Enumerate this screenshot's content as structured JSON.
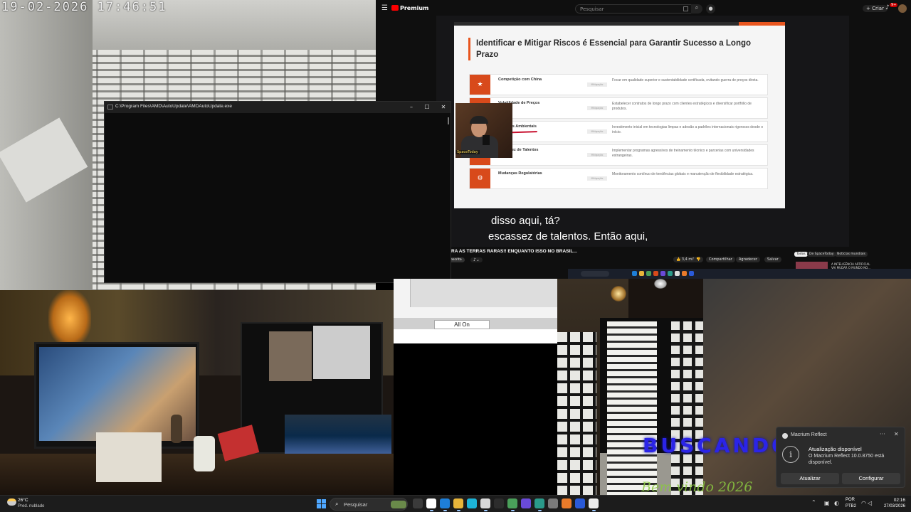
{
  "camera_top_left": {
    "timestamp": "19-02-2026  17:46:51"
  },
  "youtube": {
    "brand": "Premium",
    "search_placeholder": "Pesquisar",
    "create_label": "+ Criar",
    "notification_count": "9+",
    "slide": {
      "title": "Identificar e Mitigar Riscos é Essencial para Garantir Sucesso a Longo Prazo",
      "rows": [
        {
          "name": "Competição com China",
          "tag": "Mitigação",
          "desc": "Focar em qualidade superior e sustentabilidade certificada, evitando guerra de preços direta."
        },
        {
          "name": "Volatilidade de Preços",
          "tag": "Mitigação",
          "desc": "Estabelecer contratos de longo prazo com clientes estratégicos e diversificar portfólio de produtos."
        },
        {
          "name": "Desafios Ambientais",
          "tag": "Mitigação",
          "desc": "Investimento inicial em tecnologias limpas e adesão a padrões internacionais rigorosos desde o início."
        },
        {
          "name": "Escassez de Talentos",
          "tag": "Mitigação",
          "desc": "Implementar programas agressivos de treinamento técnico e parcerias com universidades estrangeiras."
        },
        {
          "name": "Mudanças Regulatórias",
          "tag": "Mitigação",
          "desc": "Monitoramento contínuo de tendências globais e manutenção de flexibilidade estratégica."
        }
      ]
    },
    "pip_label": "SpaceToday",
    "captions": [
      "disso aqui, tá?",
      "escassez de talentos. Então aqui,"
    ],
    "video_title": "RA AS TERRAS RARAS!! ENQUANTO ISSO NO BRASIL...",
    "subscribed_label": "Inscrito",
    "actions": {
      "likes": "3,4 mil",
      "share": "Compartilhar",
      "thanks": "Agradecer",
      "save": "Salvar"
    },
    "chips": [
      "Todos",
      "De SpaceToday",
      "Notícias mundiais"
    ],
    "side_video_title": "A INTELIGÊNCIA ARTIFICIAL VAI MUDAR O MUNDO NO..."
  },
  "cmd_window": {
    "title": "C:\\Program Files\\AMD\\AutoUpdate\\AMDAutoUpdate.exe",
    "minimize": "–",
    "maximize": "☐",
    "close": "✕"
  },
  "fragment": {
    "button_label": "All On"
  },
  "camera_bottom_right": {
    "graffiti_1": "BUSCANDO SAL",
    "graffiti_2": "Bem vindo 2026"
  },
  "notification": {
    "app_name": "Macrium Reflect",
    "title": "Atualização disponível",
    "body": "O Macrium Reflect 10.0.8750 está disponível.",
    "primary_button": "Atualizar",
    "secondary_button": "Configurar"
  },
  "taskbar": {
    "weather_temp": "26°C",
    "weather_desc": "Pred. nublado",
    "search_placeholder": "Pesquisar",
    "language_1": "POR",
    "language_2": "PTB2",
    "time": "02:16",
    "date": "27/03/2026",
    "app_colors": [
      "#3a3a3a",
      "#ffffff",
      "#1e7fd8",
      "#e8b53a",
      "#1db4d8",
      "#d8d8d8",
      "#2c2c2c",
      "#4aa05a",
      "#6a4ad8",
      "#2a9a8a",
      "#7a7a7a",
      "#e87a2a",
      "#2a5ad8",
      "#eeeeee"
    ]
  }
}
